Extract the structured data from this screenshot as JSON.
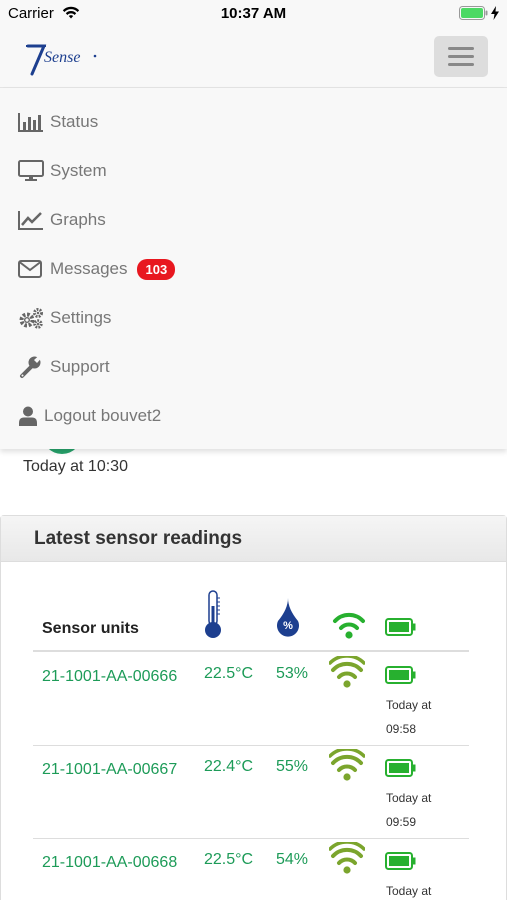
{
  "status_bar": {
    "carrier": "Carrier",
    "time": "10:37 AM"
  },
  "brand": {
    "logo_text": "7Sense"
  },
  "menu": {
    "items": [
      {
        "label": "Status",
        "icon": "bar-chart-icon"
      },
      {
        "label": "System",
        "icon": "monitor-icon"
      },
      {
        "label": "Graphs",
        "icon": "line-chart-icon"
      },
      {
        "label": "Messages",
        "icon": "envelope-icon",
        "badge": "103"
      },
      {
        "label": "Settings",
        "icon": "gears-icon"
      },
      {
        "label": "Support",
        "icon": "wrench-icon"
      },
      {
        "label": "Logout bouvet2",
        "icon": "user-icon"
      }
    ]
  },
  "background": {
    "today_line": "Today at 10:30"
  },
  "readings": {
    "title": "Latest sensor readings",
    "columns": {
      "sensor": "Sensor units"
    },
    "rows": [
      {
        "sensor": "21-1001-AA-00666",
        "temp": "22.5°C",
        "humidity": "53%",
        "time_label": "Today at",
        "time": "09:58"
      },
      {
        "sensor": "21-1001-AA-00667",
        "temp": "22.4°C",
        "humidity": "55%",
        "time_label": "Today at",
        "time": "09:59"
      },
      {
        "sensor": "21-1001-AA-00668",
        "temp": "22.5°C",
        "humidity": "54%",
        "time_label": "Today at",
        "time": ""
      }
    ]
  },
  "colors": {
    "accent_green": "#1d9b58",
    "badge_red": "#e8171f",
    "brand_blue": "#1d3f8f",
    "signal_green": "#7ba52d"
  }
}
